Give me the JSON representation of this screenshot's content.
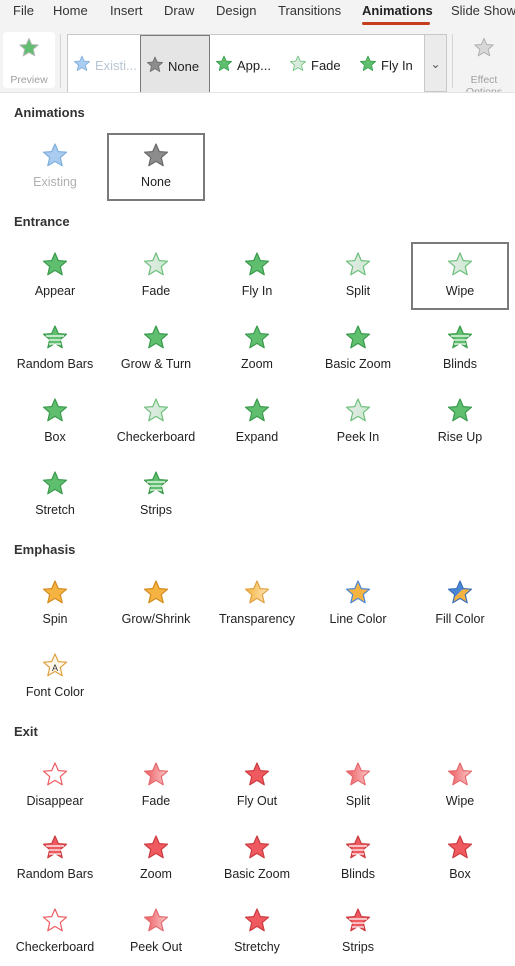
{
  "tabs": [
    "File",
    "Home",
    "Insert",
    "Draw",
    "Design",
    "Transitions",
    "Animations",
    "Slide Show"
  ],
  "ribbon": {
    "preview_label": "Preview",
    "gallery_items": [
      {
        "label": "Existi...",
        "icon": "existing-star-icon",
        "style": "existing"
      },
      {
        "label": "None",
        "icon": "none-star-icon",
        "style": "none"
      },
      {
        "label": "App...",
        "icon": "appear-star-icon",
        "style": "green"
      },
      {
        "label": "Fade",
        "icon": "fade-star-icon",
        "style": "green-fade"
      },
      {
        "label": "Fly In",
        "icon": "fly-in-star-icon",
        "style": "green"
      }
    ],
    "more_glyph": "⌄",
    "effect_label": "Effect Options"
  },
  "sections": [
    {
      "title": "Animations",
      "items": [
        {
          "label": "Existing",
          "icon": "existing-star-icon",
          "style": "existing",
          "dim": true
        },
        {
          "label": "None",
          "icon": "none-star-icon",
          "style": "none",
          "outlined": true
        }
      ]
    },
    {
      "title": "Entrance",
      "items": [
        {
          "label": "Appear",
          "icon": "appear-star-icon",
          "style": "green"
        },
        {
          "label": "Fade",
          "icon": "fade-star-icon",
          "style": "green-fade"
        },
        {
          "label": "Fly In",
          "icon": "fly-in-star-icon",
          "style": "green"
        },
        {
          "label": "Split",
          "icon": "split-star-icon",
          "style": "green-fade"
        },
        {
          "label": "Wipe",
          "icon": "wipe-star-icon",
          "style": "green-fade",
          "outlined": true
        },
        {
          "label": "Random Bars",
          "icon": "random-bars-star-icon",
          "style": "green-bars"
        },
        {
          "label": "Grow & Turn",
          "icon": "grow-turn-star-icon",
          "style": "green"
        },
        {
          "label": "Zoom",
          "icon": "zoom-star-icon",
          "style": "green"
        },
        {
          "label": "Basic Zoom",
          "icon": "basic-zoom-star-icon",
          "style": "green"
        },
        {
          "label": "Blinds",
          "icon": "blinds-star-icon",
          "style": "green-bars"
        },
        {
          "label": "Box",
          "icon": "box-star-icon",
          "style": "green"
        },
        {
          "label": "Checkerboard",
          "icon": "checkerboard-star-icon",
          "style": "green-fade"
        },
        {
          "label": "Expand",
          "icon": "expand-star-icon",
          "style": "green"
        },
        {
          "label": "Peek In",
          "icon": "peek-in-star-icon",
          "style": "green-fade"
        },
        {
          "label": "Rise Up",
          "icon": "rise-up-star-icon",
          "style": "green"
        },
        {
          "label": "Stretch",
          "icon": "stretch-star-icon",
          "style": "green"
        },
        {
          "label": "Strips",
          "icon": "strips-star-icon",
          "style": "green-bars"
        }
      ]
    },
    {
      "title": "Emphasis",
      "items": [
        {
          "label": "Spin",
          "icon": "spin-star-icon",
          "style": "orange"
        },
        {
          "label": "Grow/Shrink",
          "icon": "grow-shrink-star-icon",
          "style": "orange"
        },
        {
          "label": "Transparency",
          "icon": "transparency-star-icon",
          "style": "orange-fade"
        },
        {
          "label": "Line Color",
          "icon": "line-color-star-icon",
          "style": "orange-blue-line"
        },
        {
          "label": "Fill Color",
          "icon": "fill-color-star-icon",
          "style": "orange-blue-fill"
        },
        {
          "label": "Font Color",
          "icon": "font-color-star-icon",
          "style": "orange-font"
        }
      ]
    },
    {
      "title": "Exit",
      "items": [
        {
          "label": "Disappear",
          "icon": "disappear-star-icon",
          "style": "red-outline"
        },
        {
          "label": "Fade",
          "icon": "fade-star-icon",
          "style": "red-fade"
        },
        {
          "label": "Fly Out",
          "icon": "fly-out-star-icon",
          "style": "red"
        },
        {
          "label": "Split",
          "icon": "split-star-icon",
          "style": "red-fade"
        },
        {
          "label": "Wipe",
          "icon": "wipe-star-icon",
          "style": "red-fade"
        },
        {
          "label": "Random Bars",
          "icon": "random-bars-star-icon",
          "style": "red-bars"
        },
        {
          "label": "Zoom",
          "icon": "zoom-star-icon",
          "style": "red"
        },
        {
          "label": "Basic Zoom",
          "icon": "basic-zoom-star-icon",
          "style": "red"
        },
        {
          "label": "Blinds",
          "icon": "blinds-star-icon",
          "style": "red-bars"
        },
        {
          "label": "Box",
          "icon": "box-star-icon",
          "style": "red"
        },
        {
          "label": "Checkerboard",
          "icon": "checkerboard-star-icon",
          "style": "red-outline"
        },
        {
          "label": "Peek Out",
          "icon": "peek-out-star-icon",
          "style": "red-fade"
        },
        {
          "label": "Stretchy",
          "icon": "stretchy-star-icon",
          "style": "red"
        },
        {
          "label": "Strips",
          "icon": "strips-star-icon",
          "style": "red-bars"
        }
      ]
    }
  ],
  "colors": {
    "tab_accent": "#c43e1c",
    "green": "#5fbf6f",
    "green_light": "#c9ecd0",
    "orange": "#f5b342",
    "red": "#ee5a5f",
    "red_light": "#f9c9cb",
    "blue": "#4a86d8",
    "existing": "#a9ccf0",
    "none": "#8c8c8c"
  }
}
